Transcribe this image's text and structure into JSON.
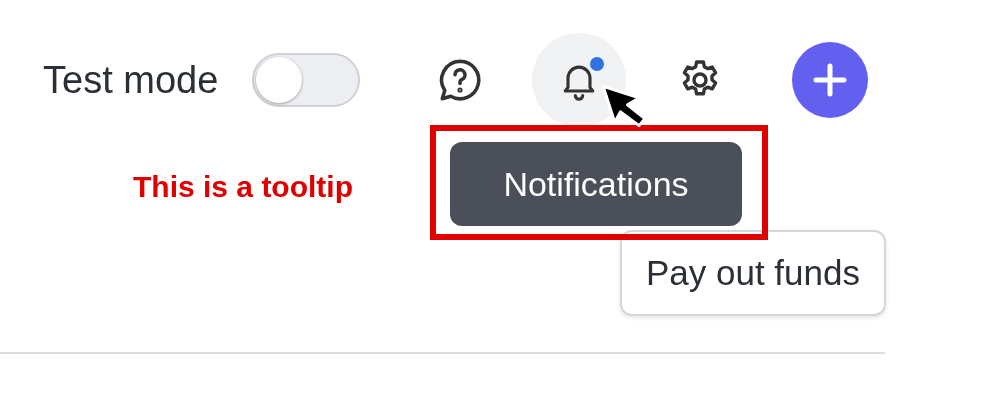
{
  "test_mode": {
    "label": "Test mode",
    "on": false
  },
  "toolbar": [
    {
      "kind": "help"
    },
    {
      "kind": "notifications",
      "unread": true,
      "hovered": true
    },
    {
      "kind": "settings"
    },
    {
      "kind": "add"
    }
  ],
  "tooltip": {
    "text": "Notifications"
  },
  "annotation": {
    "text": "This is a tooltip"
  },
  "buttons": [
    "Pay out funds"
  ]
}
